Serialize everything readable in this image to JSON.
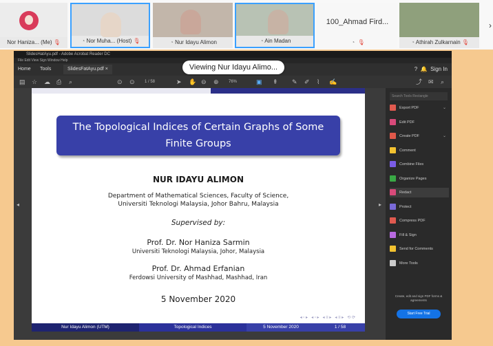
{
  "participants": [
    {
      "name": "Nor Haniza...",
      "tag": "(Me)",
      "mic": "off"
    },
    {
      "name": "Nor Muha...",
      "tag": "(Host)",
      "mic": "off",
      "active": true
    },
    {
      "name": "Nur Idayu Alimon",
      "mic": "on"
    },
    {
      "name": "Ain Madan",
      "mic": "on",
      "active": true
    },
    {
      "name": "100_Ahmad Fird...",
      "mic": "off"
    },
    {
      "name": "Athirah Zulkarnain",
      "mic": "off"
    }
  ],
  "share_banner": "Viewing Nur Idayu Alimo...",
  "app": {
    "window_title": "SlidesHatAyu.pdf - Adobe Acrobat Reader DC",
    "menu": "File  Edit  View  Sign  Window  Help",
    "tab_home": "Home",
    "tab_tools": "Tools",
    "tab_doc": "SlidesFatAyu.pdf ×",
    "help": "?",
    "sign_in": "Sign In",
    "zoom": "76%",
    "page_nav": "1 / 58"
  },
  "slide": {
    "title": "The Topological Indices of Certain Graphs of Some Finite Groups",
    "author": "NUR IDAYU ALIMON",
    "dept_line1": "Department of Mathematical Sciences, Faculty of Science,",
    "dept_line2": "Universiti Teknologi Malaysia, Johor Bahru, Malaysia",
    "supervised": "Supervised by:",
    "prof1": "Prof. Dr. Nor Haniza Sarmin",
    "aff1": "Universiti Teknologi Malaysia, Johor, Malaysia",
    "prof2": "Prof. Dr. Ahmad Erfanian",
    "aff2": "Ferdowsi University of Mashhad, Mashhad, Iran",
    "date": "5 November 2020",
    "footer_author": "Nur Idayu Alimon (UTM)",
    "footer_title": "Topological Indices",
    "footer_date": "5 November 2020",
    "footer_page": "1 / 58"
  },
  "tools_panel": {
    "search_placeholder": "Search Tools Rectangle",
    "items": [
      {
        "label": "Export PDF",
        "color": "#e05a4f",
        "chevron": true
      },
      {
        "label": "Edit PDF",
        "color": "#d84a7a"
      },
      {
        "label": "Create PDF",
        "color": "#e0584a",
        "chevron": true
      },
      {
        "label": "Comment",
        "color": "#f2c230"
      },
      {
        "label": "Combine Files",
        "color": "#7a5ce6"
      },
      {
        "label": "Organize Pages",
        "color": "#39a845"
      },
      {
        "label": "Redact",
        "color": "#d84a7a",
        "selected": true
      },
      {
        "label": "Protect",
        "color": "#7a6ad8"
      },
      {
        "label": "Compress PDF",
        "color": "#e05a4f"
      },
      {
        "label": "Fill & Sign",
        "color": "#b86ae0"
      },
      {
        "label": "Send for Comments",
        "color": "#f2c230"
      },
      {
        "label": "More Tools",
        "color": "#cccccc"
      }
    ],
    "promo": "Create, edit and sign PDF forms & agreements",
    "trial_button": "Start Free Trial"
  }
}
